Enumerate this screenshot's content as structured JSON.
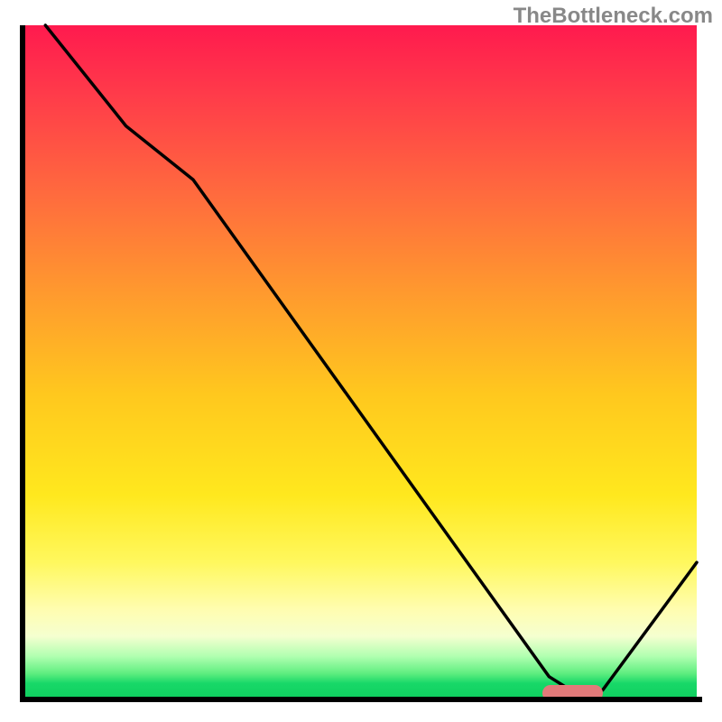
{
  "watermark": "TheBottleneck.com",
  "chart_data": {
    "type": "line",
    "title": "",
    "xlabel": "",
    "ylabel": "",
    "xlim": [
      0,
      100
    ],
    "ylim": [
      0,
      100
    ],
    "series": [
      {
        "name": "bottleneck-curve",
        "x": [
          3,
          15,
          25,
          78,
          82,
          86,
          100
        ],
        "values": [
          100,
          85,
          77,
          3,
          0.5,
          1,
          20
        ]
      }
    ],
    "annotations": [
      {
        "name": "optimal-range-marker",
        "x_start": 77,
        "x_end": 86,
        "y": 0.5,
        "color": "#e27a7a"
      }
    ],
    "background_gradient": {
      "orientation": "vertical",
      "stops": [
        {
          "pos": 0.0,
          "color": "#ff1a4e"
        },
        {
          "pos": 0.3,
          "color": "#ff7a36"
        },
        {
          "pos": 0.6,
          "color": "#ffd81e"
        },
        {
          "pos": 0.88,
          "color": "#fffdb0"
        },
        {
          "pos": 1.0,
          "color": "#10d060"
        }
      ]
    }
  }
}
